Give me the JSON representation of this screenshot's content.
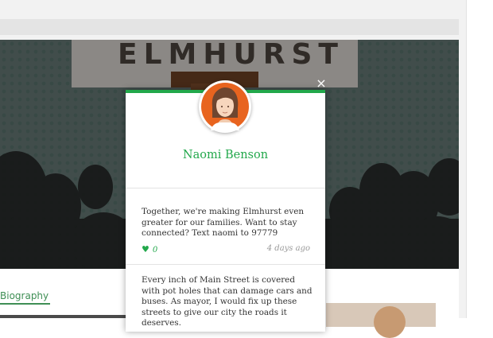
{
  "modal": {
    "name": "Naomi Benson",
    "close_icon": "×",
    "posts": [
      {
        "text": "Together, we're making Elmhurst even greater for our families. Want to stay connected? Text naomi to 97779",
        "likes": "0",
        "timestamp": "4 days ago"
      },
      {
        "text": "Every inch of Main Street is covered with pot holes that can damage cars and buses. As mayor, I would fix up these streets to give our city the roads it deserves."
      }
    ]
  },
  "hero": {
    "banner_text": "ELMHURST"
  },
  "page": {
    "tab_biography": "Biography"
  },
  "colors": {
    "accent": "#22a84b",
    "avatar_bg": "#e8641f"
  },
  "icons": {
    "close": "close-icon",
    "like": "heart-icon",
    "avatar": "avatar-icon"
  }
}
